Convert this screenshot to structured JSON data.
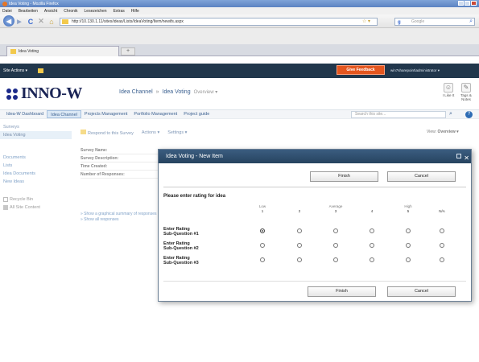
{
  "browser": {
    "window_title": "Idea Voting - Mozilla Firefox",
    "menu": [
      "Datei",
      "Bearbeiten",
      "Ansicht",
      "Chronik",
      "Lesezeichen",
      "Extras",
      "Hilfe"
    ],
    "url": "http://10.130.1.11/sites/ideas/Lists/IdeaVoting/Item/newifs.aspx",
    "search_placeholder": "Google",
    "tab_title": "Idea Voting",
    "new_tab": "+",
    "back": "◀",
    "forward": "▶",
    "reload": "C",
    "stop": "✕",
    "home": "⌂",
    "star": "☆ ▾"
  },
  "sp": {
    "site_actions": "Site Actions ▾",
    "feedback": "Give Feedback",
    "user": "win7sharepoint\\administrator ▾",
    "logo_text": "INNO-W",
    "breadcrumb": {
      "channel": "Idea Channel",
      "sep": "»",
      "list": "Idea Voting",
      "view": "Overview ▾"
    },
    "edit_icons": [
      {
        "label": "I Like It",
        "glyph": "☺"
      },
      {
        "label": "Tags & Notes",
        "glyph": "✎"
      }
    ],
    "topnav": [
      "Idea-W Dashboard",
      "Idea Channel",
      "Projects Management",
      "Portfolio Management",
      "Project guide"
    ],
    "search_placeholder": "Search this site...",
    "search_btn": "⌕",
    "help": "?",
    "leftnav": {
      "surveys_head": "Surveys",
      "selected_item": "Idea Voting",
      "links": [
        "Documents",
        "Lists",
        "Idea Documents",
        "New Ideas"
      ],
      "recycle": "Recycle Bin",
      "all_content": "All Site Content"
    },
    "toolbar": {
      "respond": "Respond to this Survey",
      "actions": "Actions ▾",
      "settings": "Settings ▾",
      "view_label": "View:",
      "view_value": "Overview ▾"
    },
    "props": [
      "Survey Name:",
      "Survey Description:",
      "Time Created:",
      "Number of Responses:"
    ],
    "main_links": [
      "» Show a graphical summary of responses",
      "» Show all responses"
    ]
  },
  "dialog": {
    "title": "Idea Voting - New Item",
    "close": "✕",
    "finish": "Finish",
    "cancel": "Cancel",
    "prompt": "Please enter rating for idea",
    "scale": [
      {
        "top": "Low",
        "num": "1"
      },
      {
        "top": "",
        "num": "2"
      },
      {
        "top": "Average",
        "num": "3"
      },
      {
        "top": "",
        "num": "4"
      },
      {
        "top": "High",
        "num": "5"
      },
      {
        "top": "",
        "num": "N/A"
      }
    ],
    "questions": [
      {
        "line1": "Enter Rating",
        "line2": "Sub-Question #1",
        "selected": 0
      },
      {
        "line1": "Enter Rating",
        "line2": "Sub-Question #2",
        "selected": -1
      },
      {
        "line1": "Enter Rating",
        "line2": "Sub-Question #3",
        "selected": -1
      }
    ]
  }
}
